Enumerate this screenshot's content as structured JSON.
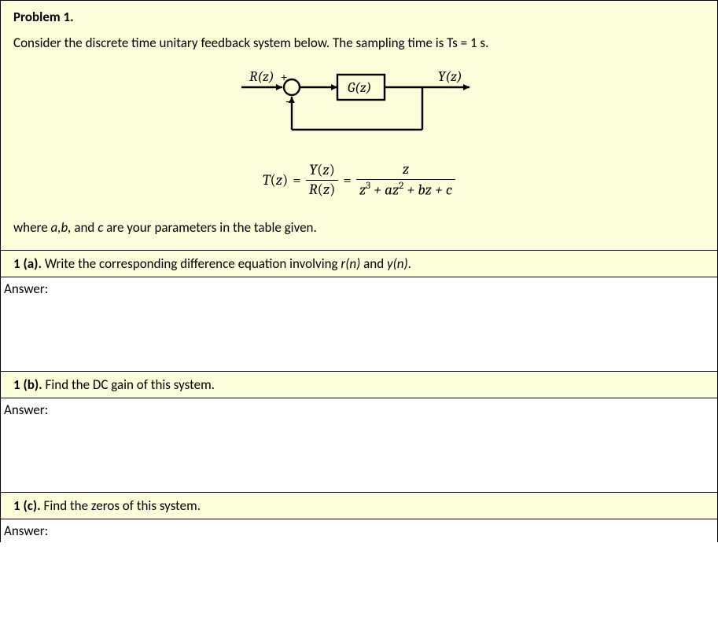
{
  "problem": {
    "heading": "Problem 1.",
    "intro": "Consider the discrete time unitary feedback system below. The sampling time is Ts = 1 s.",
    "param_note_prefix": "where ",
    "param_note_vars": "a,b,",
    "param_note_and": " and ",
    "param_note_c": "c",
    "param_note_suffix": " are your parameters in the table given."
  },
  "diagram": {
    "r_label": "R(z)",
    "y_label": "Y(z)",
    "g_label": "G(z)",
    "plus": "+",
    "minus": "−"
  },
  "equation": {
    "T": "T",
    "z": "z",
    "eq": "=",
    "Y": "Y",
    "R": "R",
    "num2": "z",
    "den2_a": "z",
    "den2_b": " + az",
    "den2_c": " + bz + c",
    "p3": "3",
    "p2": "2"
  },
  "parts": {
    "a": {
      "label": "1 (a).",
      "text": " Write the corresponding difference equation involving ",
      "r": "r(n)",
      "and": " and ",
      "y": "y(n)",
      "end": "."
    },
    "b": {
      "label": "1 (b).",
      "text": " Find the DC gain of this system."
    },
    "c": {
      "label": "1 (c).",
      "text": " Find the zeros of this system."
    },
    "answer_label": "Answer:"
  }
}
